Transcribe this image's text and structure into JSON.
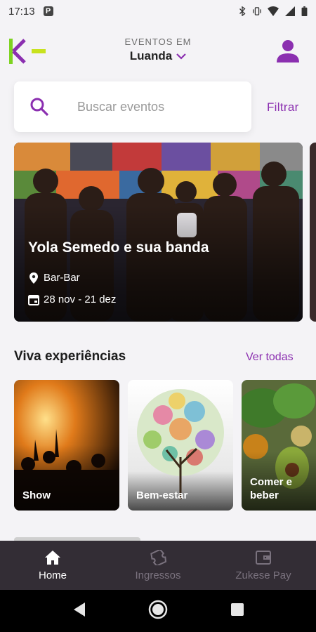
{
  "status_bar": {
    "time": "17:13",
    "notification_icon": "P"
  },
  "header": {
    "caption": "EVENTOS EM",
    "city": "Luanda"
  },
  "search": {
    "placeholder": "Buscar eventos",
    "filter_label": "Filtrar"
  },
  "hero": {
    "title": "Yola Semedo e sua banda",
    "venue": "Bar-Bar",
    "dates": "28 nov - 21 dez"
  },
  "experiences": {
    "title": "Viva experiências",
    "see_all": "Ver todas",
    "categories": [
      {
        "label": "Show"
      },
      {
        "label": "Bem-estar"
      },
      {
        "label": "Comer e beber"
      }
    ]
  },
  "bottom_nav": {
    "items": [
      {
        "label": "Home",
        "icon": "home-icon",
        "active": true
      },
      {
        "label": "Ingressos",
        "icon": "ticket-icon",
        "active": false
      },
      {
        "label": "Zukese Pay",
        "icon": "wallet-icon",
        "active": false
      }
    ]
  },
  "colors": {
    "accent": "#8b2fb0",
    "logo_green": "#7ed321",
    "nav_bg": "#332d35"
  }
}
